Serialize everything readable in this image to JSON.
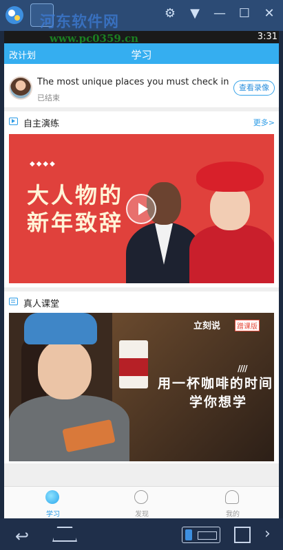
{
  "emulator": {
    "watermark_title": "河东软件网",
    "watermark_url": "www.pc0359.cn",
    "controls": [
      "⚙",
      "▼",
      "—",
      "☐",
      "✕"
    ]
  },
  "status_bar": {
    "time": "3:31"
  },
  "header": {
    "left_label": "改计划",
    "title": "学习"
  },
  "live": {
    "title": "The most unique places you must check in A.",
    "status": "已结束",
    "replay_label": "查看录像"
  },
  "section_practice": {
    "title": "自主演练",
    "more_label": "更多>",
    "banner_text_line1": "大人物的",
    "banner_text_line2": "新年致辞",
    "banner_diamonds": "◆◆◆◆"
  },
  "section_class": {
    "title": "真人课堂",
    "brand": "立刻说",
    "brand_tag": "蹭课版",
    "slashes": "////",
    "banner_text_line1": "用一杯咖啡的时间",
    "banner_text_line2": "学你想学"
  },
  "tabs": [
    {
      "label": "学习",
      "active": true
    },
    {
      "label": "发现",
      "active": false
    },
    {
      "label": "我的",
      "active": false
    }
  ],
  "nav": {
    "back_glyph": "↩",
    "more_glyph": "›"
  },
  "colors": {
    "accent": "#35aef0",
    "banner_red": "#e0413c"
  }
}
